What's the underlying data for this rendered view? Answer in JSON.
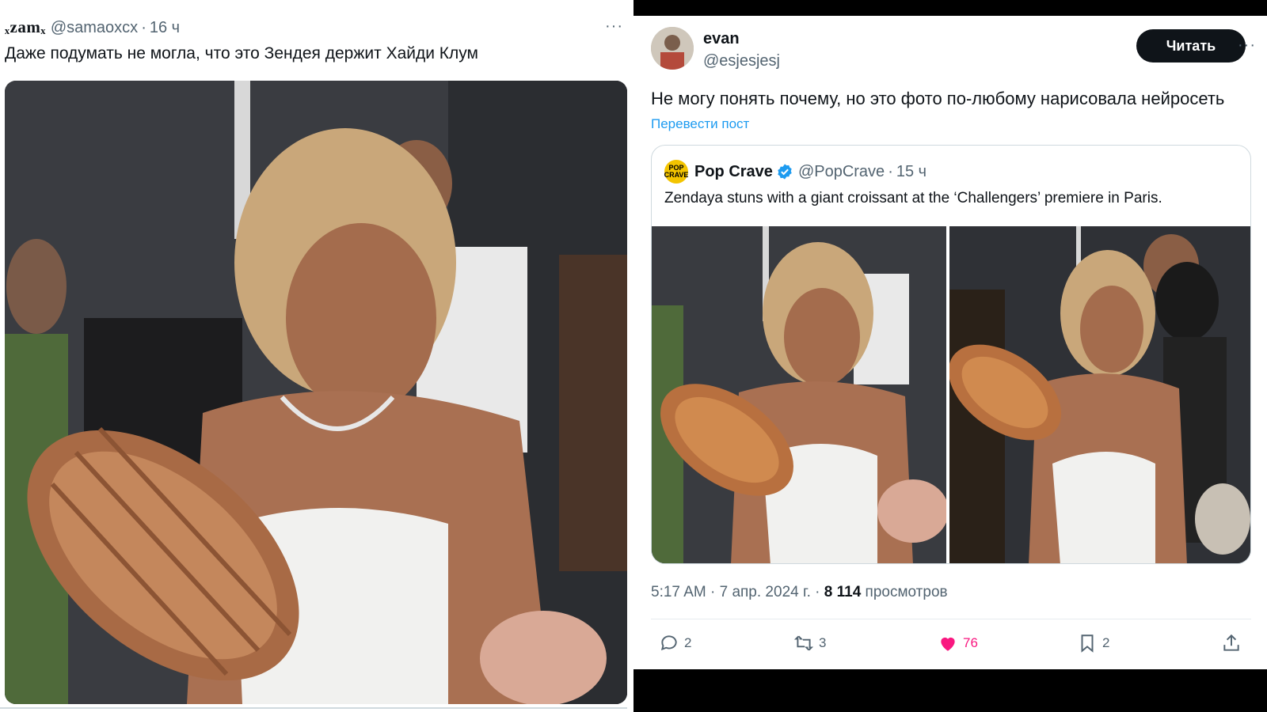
{
  "left_post": {
    "author_name": "ₓzamₓ",
    "handle": "@samaoxcx",
    "time": "16 ч",
    "text": "Даже подумать не могла, что это Зендея держит Хайди Клум",
    "more": "···"
  },
  "right_post": {
    "author_name": "evan",
    "handle": "@esjesjesj",
    "follow_label": "Читать",
    "more": "···",
    "text": "Не могу понять почему, но это фото по-любому нарисовала нейросеть",
    "translate_label": "Перевести пост",
    "quote": {
      "avatar_text": "POP CRAVE",
      "author_name": "Pop Crave",
      "handle": "@PopCrave",
      "time": "15 ч",
      "text": "Zendaya stuns with a giant croissant at the ‘Challengers’ premiere in Paris."
    },
    "meta": {
      "time": "5:17 AM",
      "date": "7 апр. 2024 г.",
      "views_count": "8 114",
      "views_label": "просмотров"
    },
    "actions": {
      "replies": "2",
      "reposts": "3",
      "likes": "76",
      "bookmarks": "2"
    }
  },
  "colors": {
    "accent_blue": "#1d9bf0",
    "like_pink": "#f91880",
    "text_primary": "#0f1419",
    "text_secondary": "#536471"
  },
  "icons": [
    "reply-icon",
    "repost-icon",
    "like-icon",
    "bookmark-icon",
    "share-icon",
    "verified-badge-icon",
    "more-icon"
  ]
}
